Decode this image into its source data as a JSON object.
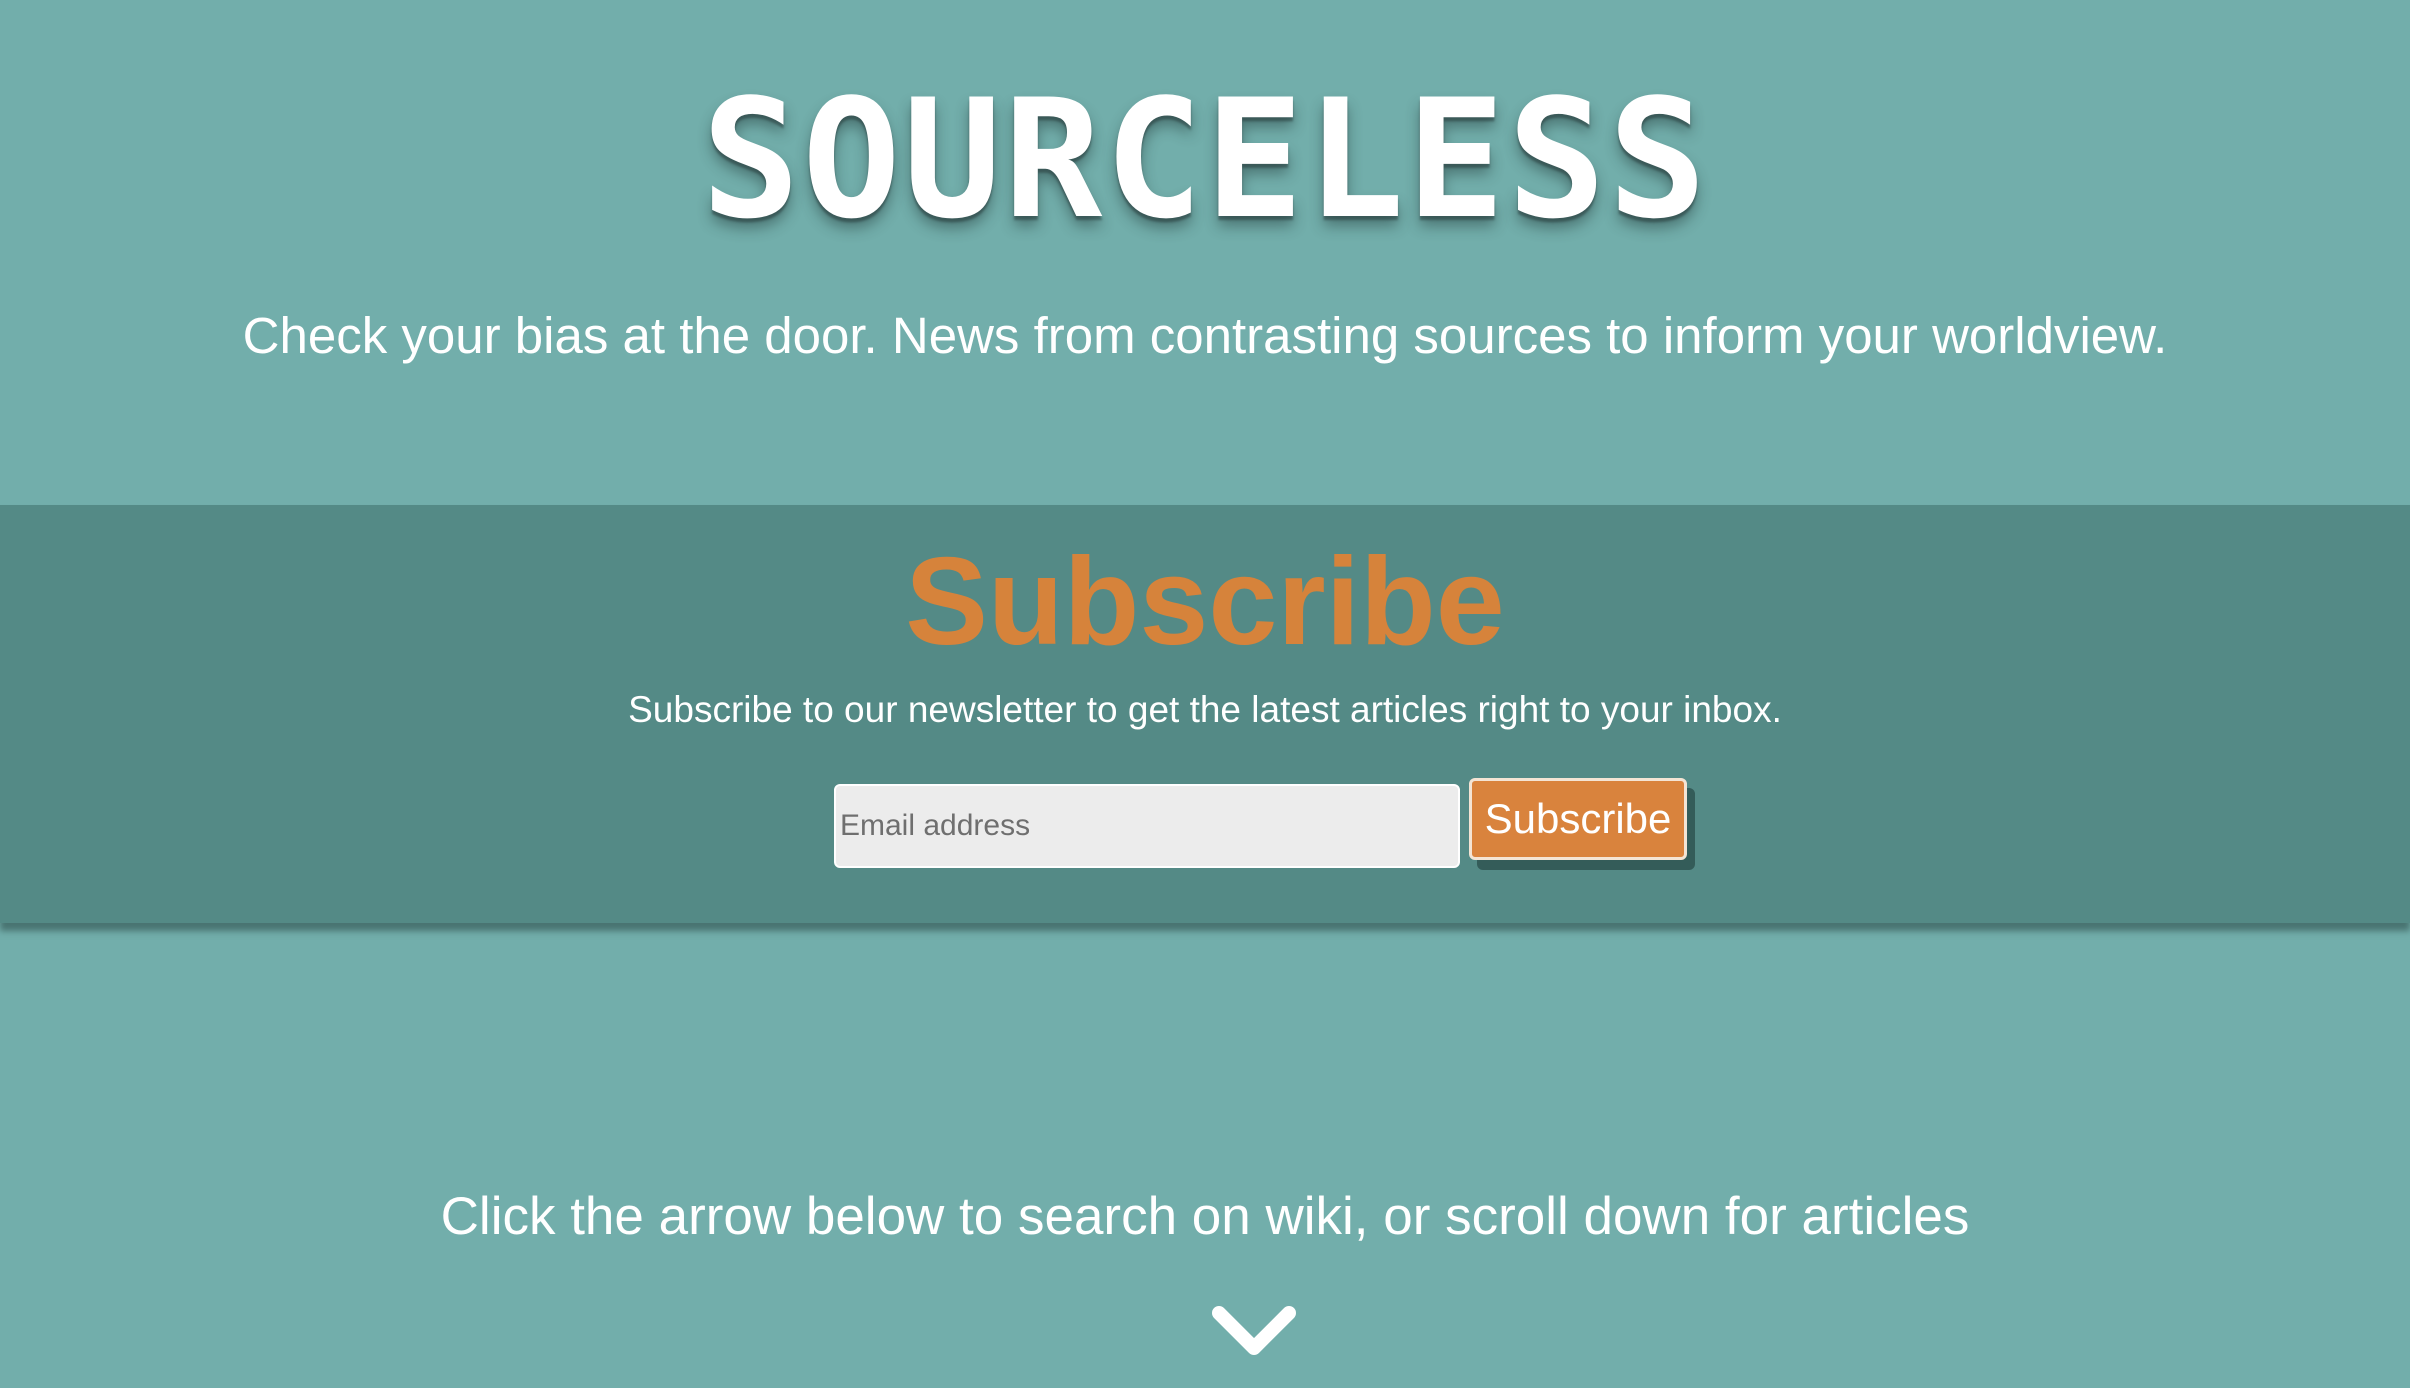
{
  "header": {
    "logo_text": "SOURCELESS",
    "tagline": "Check your bias at the door. News from contrasting sources to inform your worldview."
  },
  "subscribe": {
    "title": "Subscribe",
    "description": "Subscribe to our newsletter to get the latest articles right to your inbox.",
    "email_placeholder": "Email address",
    "button_label": "Subscribe"
  },
  "cta": {
    "text": "Click the arrow below to search on wiki, or scroll down for articles",
    "arrow_icon": "chevron-down-icon"
  },
  "colors": {
    "background": "#72aeab",
    "band": "#548a86",
    "accent": "#d6833b"
  }
}
